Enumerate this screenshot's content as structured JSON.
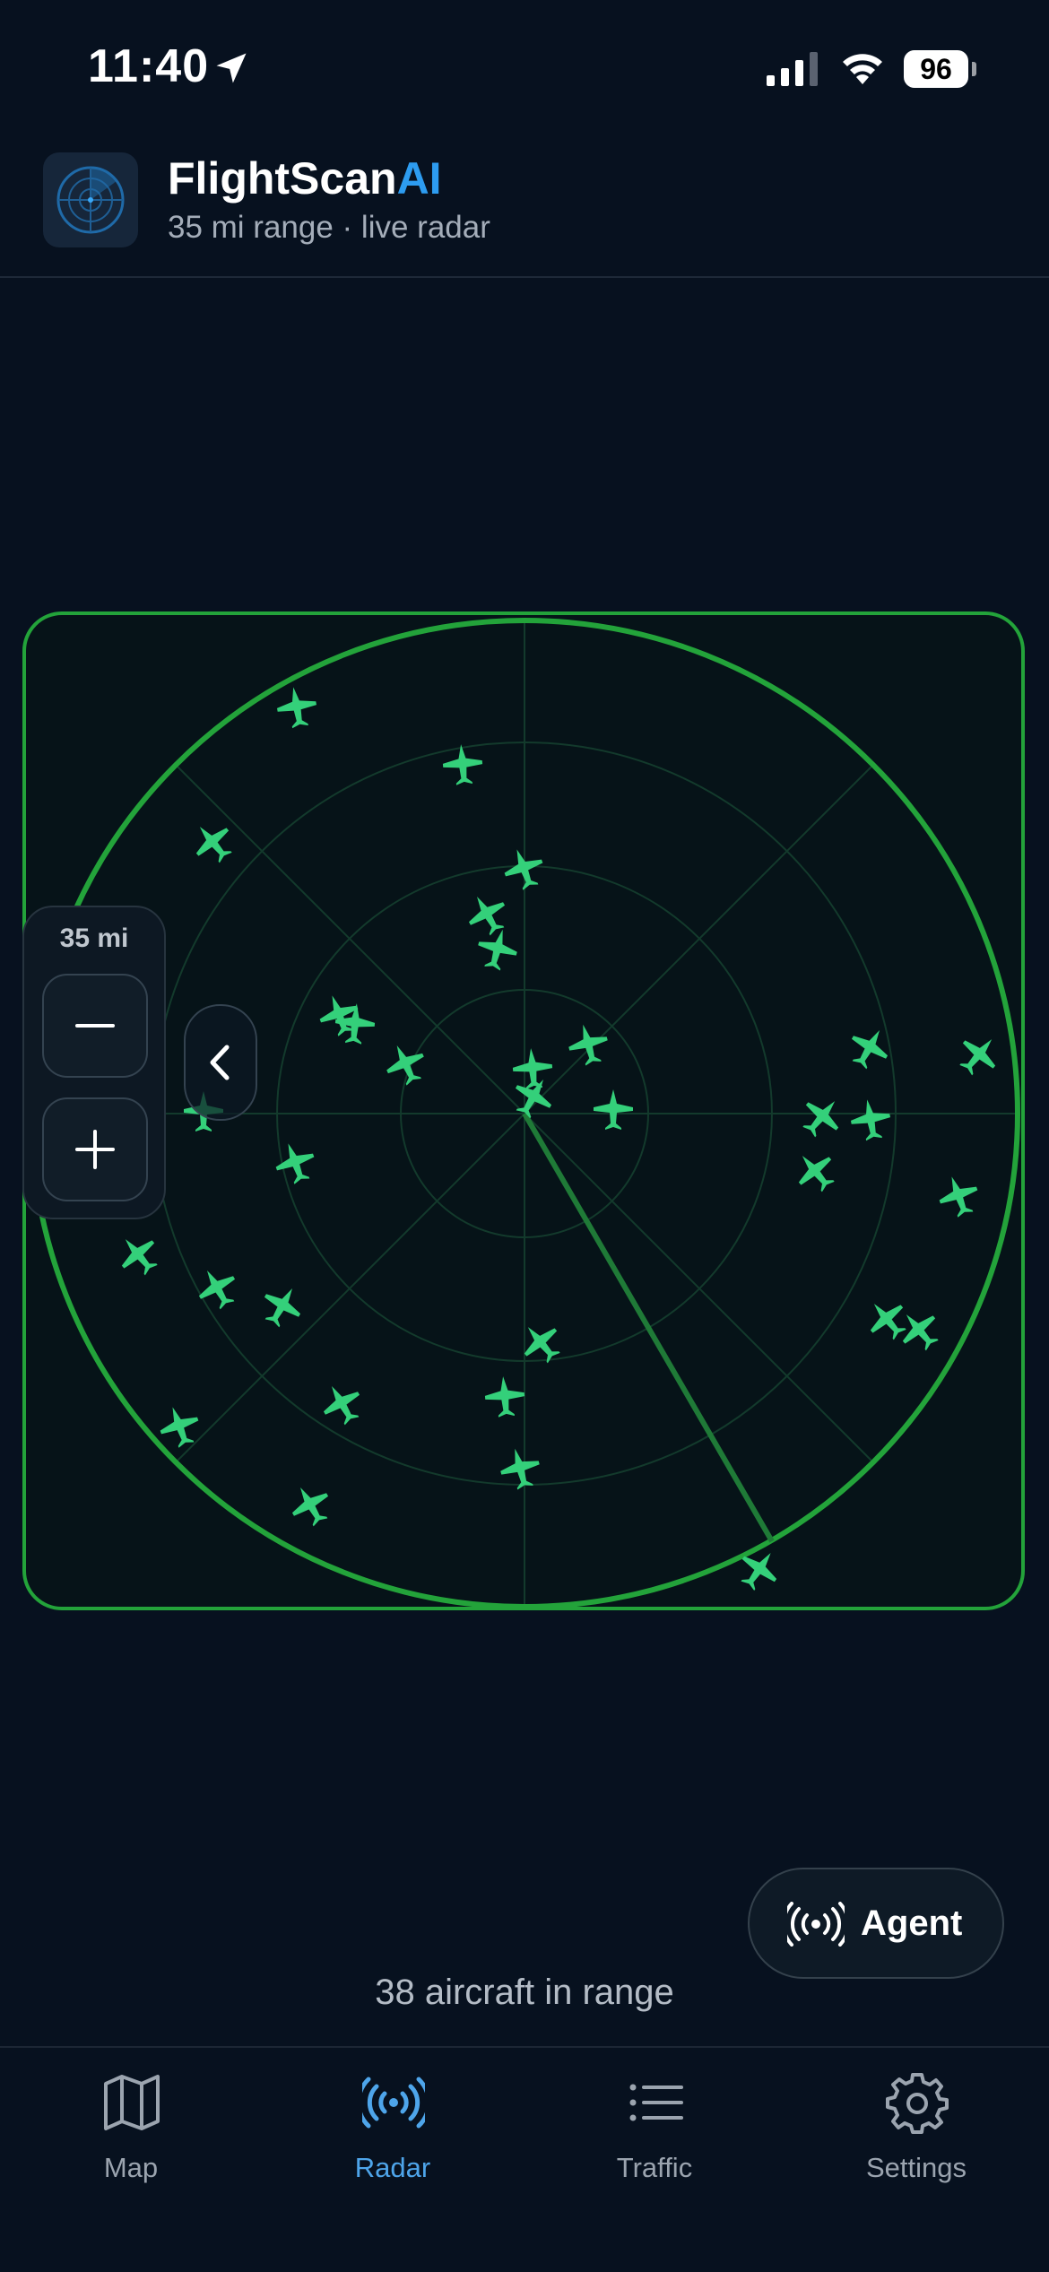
{
  "status": {
    "time": "11:40",
    "battery": "96"
  },
  "header": {
    "title_main": "FlightScan",
    "title_accent": "AI",
    "subtitle": "35 mi range · live radar"
  },
  "zoom": {
    "label": "35 mi"
  },
  "agent": {
    "label": "Agent"
  },
  "aircraft": {
    "count_text": "38 aircraft in range"
  },
  "tabs": [
    {
      "label": "Map",
      "icon": "map-icon",
      "active": false
    },
    {
      "label": "Radar",
      "icon": "radar-icon",
      "active": true
    },
    {
      "label": "Traffic",
      "icon": "list-icon",
      "active": false
    },
    {
      "label": "Settings",
      "icon": "gear-icon",
      "active": false
    }
  ],
  "colors": {
    "accent": "#2d9cf0",
    "radar_green": "#23a33a",
    "aircraft": "#34d07a",
    "background": "#07111f"
  }
}
